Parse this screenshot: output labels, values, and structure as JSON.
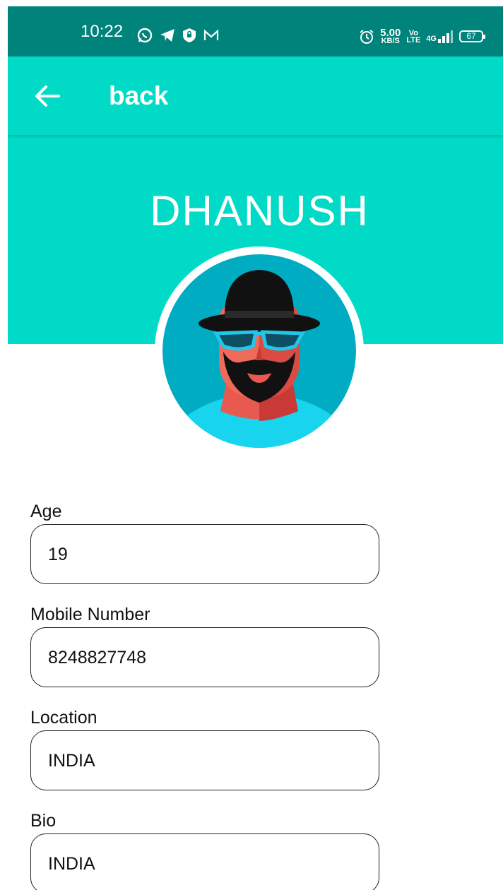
{
  "status_bar": {
    "time": "10:22",
    "network_speed_value": "5.00",
    "network_speed_unit": "KB/S",
    "volte": "Vo LTE",
    "signal": "4G",
    "battery": "67",
    "icons_left": [
      "whatsapp-icon",
      "telegram-icon",
      "vpn-shield-icon",
      "gmail-icon"
    ],
    "icons_right": [
      "alarm-icon",
      "signal-icon",
      "battery-icon"
    ]
  },
  "app_bar": {
    "back_label": "back",
    "color": "#00dac6"
  },
  "profile": {
    "name": "DHANUSH",
    "avatar": "bearded-man-with-hat-avatar"
  },
  "fields": {
    "age": {
      "label": "Age",
      "value": "19"
    },
    "mobile": {
      "label": "Mobile Number",
      "value": "8248827748"
    },
    "location": {
      "label": "Location",
      "value": "INDIA"
    },
    "bio": {
      "label": "Bio",
      "value": "INDIA"
    }
  },
  "colors": {
    "status_bar": "#00837a",
    "accent": "#00dac6",
    "avatar_bg": "#00acc1"
  }
}
